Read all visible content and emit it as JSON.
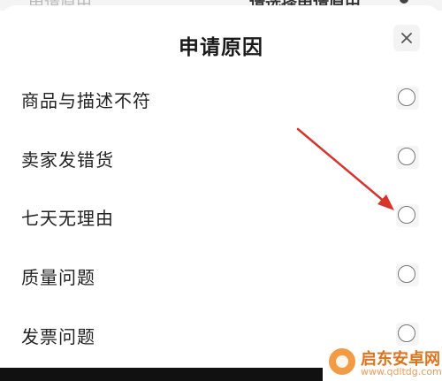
{
  "background_page": {
    "left_text": "申请原由",
    "right_text": "请选择申请原由"
  },
  "sheet": {
    "title": "申请原因",
    "close_icon": "close-icon"
  },
  "options": [
    {
      "label": "商品与描述不符",
      "selected": false
    },
    {
      "label": "卖家发错货",
      "selected": false
    },
    {
      "label": "七天无理由",
      "selected": false
    },
    {
      "label": "质量问题",
      "selected": false
    },
    {
      "label": "发票问题",
      "selected": false
    }
  ],
  "annotation": {
    "icon": "red-arrow-icon",
    "color": "#d9342b"
  },
  "watermark": {
    "name": "启东安卓网",
    "url": "www.qdltdg.com",
    "color": "#e0731a"
  }
}
